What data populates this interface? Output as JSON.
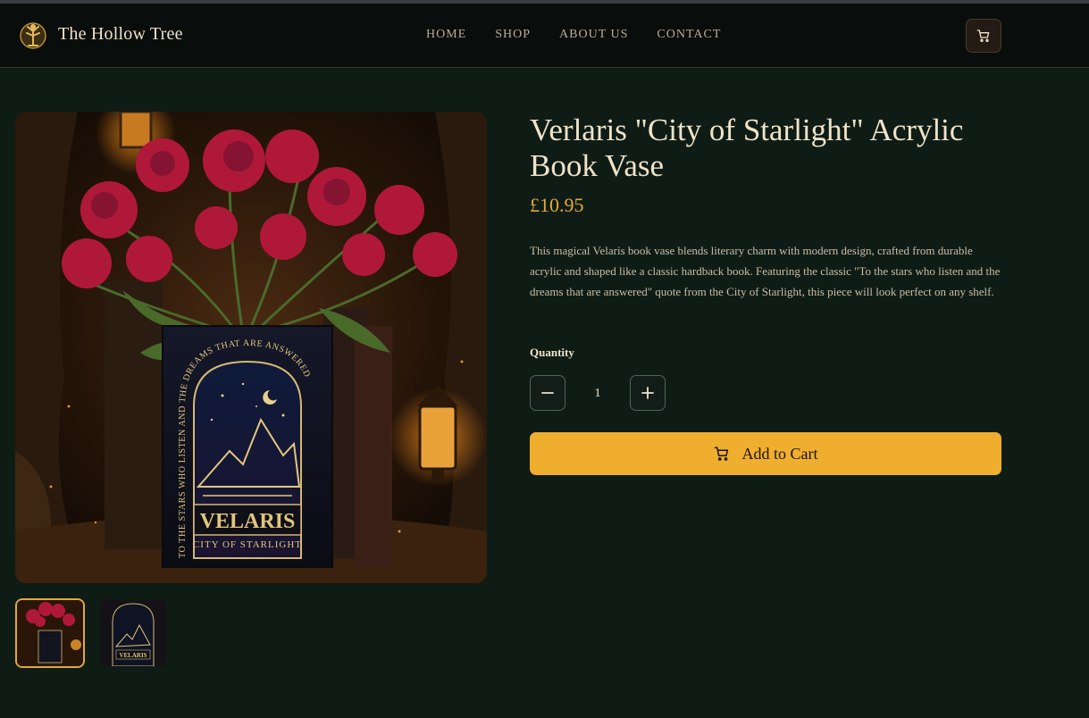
{
  "header": {
    "brand": "The Hollow Tree",
    "nav": [
      "HOME",
      "SHOP",
      "ABOUT US",
      "CONTACT"
    ],
    "cart_icon": "cart-icon"
  },
  "product": {
    "title": "Verlaris \"City of Starlight\" Acrylic Book Vase",
    "price": "£10.95",
    "description": "This magical Velaris book vase blends literary charm with modern design, crafted from durable acrylic and shaped like a classic hardback book. Featuring the classic \"To the stars who listen and the dreams that are answered\" quote from the City of Starlight, this piece will look perfect on any shelf.",
    "quantity_label": "Quantity",
    "quantity_value": "1",
    "add_to_cart_label": "Add to Cart",
    "image_text": {
      "name": "VELARIS",
      "subtitle": "CITY OF STARLIGHT",
      "quote": "TO THE STARS WHO LISTEN AND THE DREAMS THAT ARE ANSWERED"
    }
  },
  "colors": {
    "background": "#0f1c16",
    "header": "#090d0b",
    "accent": "#efae2e",
    "thumb_selected_border": "#e0a93a"
  }
}
